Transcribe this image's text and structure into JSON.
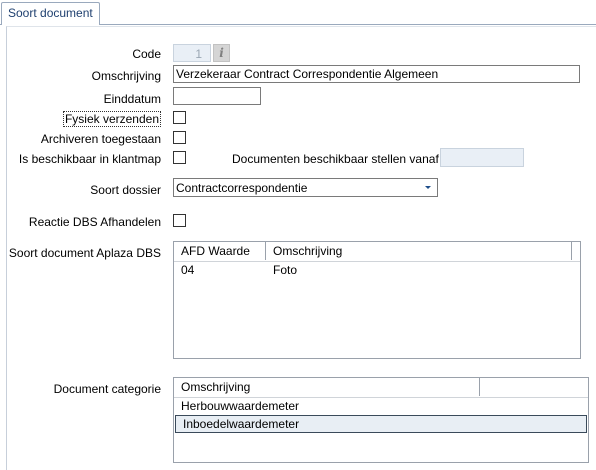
{
  "tab": {
    "label": "Soort document"
  },
  "code": {
    "label": "Code",
    "value": "1",
    "info_icon": "info-icon"
  },
  "omschrijving": {
    "label": "Omschrijving",
    "value": "Verzekeraar Contract Correspondentie Algemeen"
  },
  "einddatum": {
    "label": "Einddatum",
    "value": ""
  },
  "fysiek": {
    "label": "Fysiek verzenden",
    "checked": false
  },
  "archiveren": {
    "label": "Archiveren toegestaan",
    "checked": false
  },
  "klantmap": {
    "label": "Is beschikbaar in klantmap",
    "checked": false
  },
  "beschikbaar_vanaf": {
    "label": "Documenten beschikbaar stellen vanaf",
    "value": ""
  },
  "soort_dossier": {
    "label": "Soort dossier",
    "value": "Contractcorrespondentie"
  },
  "reactie": {
    "label": "Reactie DBS Afhandelen",
    "checked": false
  },
  "aplaza": {
    "label": "Soort document Aplaza DBS",
    "columns": [
      "AFD Waarde",
      "Omschrijving"
    ],
    "rows": [
      {
        "afd": "04",
        "omschrijving": "Foto"
      }
    ]
  },
  "categorie": {
    "label": "Document categorie",
    "columns": [
      "Omschrijving"
    ],
    "rows": [
      {
        "omschrijving": "Herbouwwaardemeter"
      },
      {
        "omschrijving": "Inboedelwaardemeter"
      }
    ]
  }
}
